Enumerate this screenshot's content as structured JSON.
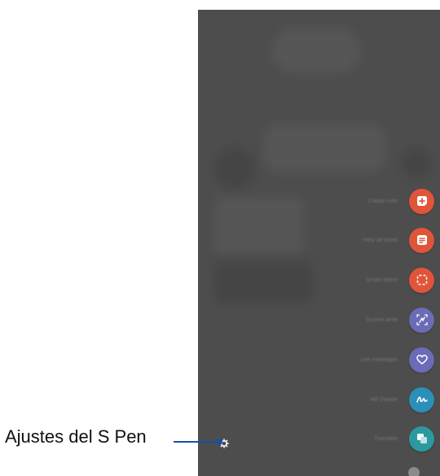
{
  "callout": {
    "label": "Ajustes del S Pen"
  },
  "air_command": {
    "items": [
      {
        "label": "Create note",
        "icon": "create-note-icon",
        "color": "#e0553a"
      },
      {
        "label": "View all notes",
        "icon": "view-all-notes-icon",
        "color": "#e0553a"
      },
      {
        "label": "Smart select",
        "icon": "smart-select-icon",
        "color": "#e0553a"
      },
      {
        "label": "Screen write",
        "icon": "screen-write-icon",
        "color": "#6b6bb8"
      },
      {
        "label": "Live messages",
        "icon": "live-messages-icon",
        "color": "#6b6bb8"
      },
      {
        "label": "AR Doodle",
        "icon": "ar-doodle-icon",
        "color": "#2b8fb8"
      },
      {
        "label": "Translate",
        "icon": "translate-icon",
        "color": "#2b9aa0"
      }
    ]
  },
  "colors": {
    "overlay": "#4d4d4d",
    "callout_line": "#1a4fa0"
  }
}
